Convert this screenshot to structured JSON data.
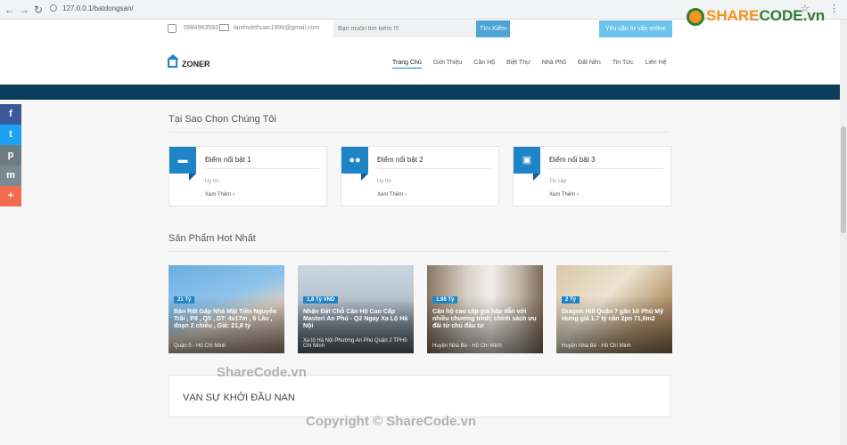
{
  "browser": {
    "url": "127.0.0.1/batdongsan/"
  },
  "topbar": {
    "phone": "0984963593",
    "email": "lamhviethuan1996@gmail.com",
    "search_placeholder": "Bạn muốn tìm kiếm !!!",
    "search_button": "Tìm Kiếm",
    "consult_button": "Yêu cầu tư vấn online"
  },
  "header": {
    "logo": "ZONER",
    "menu": [
      "Trang Chủ",
      "Giới Thiệu",
      "Căn Hộ",
      "Biệt Thự",
      "Nhà Phố",
      "Đất Nền",
      "Tin Tức",
      "Liên Hệ"
    ]
  },
  "social": [
    "f",
    "t",
    "p",
    "m",
    "+"
  ],
  "why": {
    "title": "Tại Sao Chọn Chúng Tôi",
    "features": [
      {
        "title": "Điểm nổi bật 1",
        "desc": "Uy tín",
        "more": "Xem Thêm"
      },
      {
        "title": "Điểm nổi bật 2",
        "desc": "Uy tín",
        "more": "Xem Thêm"
      },
      {
        "title": "Điểm nổi bật 3",
        "desc": "Tin cậy",
        "more": "Xem Thêm"
      }
    ]
  },
  "products": {
    "title": "Sản Phẩm Hot Nhất",
    "items": [
      {
        "price": "21 Tỷ",
        "title": "Bán Rất Gấp Nhà Mặt Tiền Nguyễn Trãi , P8 , Q5 , DT: 4x17m , 6 Lầu , đoạn 2 chiều , Giá: 21,8 tỷ",
        "location": "Quận 5 - Hồ Chí Minh"
      },
      {
        "price": "1,8 Tỷ VND",
        "title": "Nhận Đặt Chỗ Căn Hộ Cao Cấp Masteri An Phú - Q2 Ngay Xa Lộ Hà Nội",
        "location": "Xa lộ Hà Nội Phường An Phú Quận 2 TPHồ Chí Minh"
      },
      {
        "price": "1.98 Tỷ",
        "title": "Căn hộ cao cấp giá hấp dẫn với nhiều chương trình, chính sách ưu đãi từ chủ đầu tư",
        "location": "Huyện Nhà Bè - Hồ Chí Minh"
      },
      {
        "price": "2 Tỷ",
        "title": "Dragon Hill Quận 7 gần kề Phú Mỹ Hưng giá 1.7 tỷ căn 2pn 71,6m2",
        "location": "Huyện Nhà Bè - Hồ Chí Minh"
      }
    ]
  },
  "start": {
    "title": "VẠN SỰ KHỞI ĐẦU NAN"
  },
  "watermarks": {
    "logo_a": "SHARE",
    "logo_b": "CODE.vn",
    "mid": "ShareCode.vn",
    "bottom": "Copyright © ShareCode.vn"
  },
  "colors": {
    "accent": "#1d84c6",
    "band": "#0b3d5c",
    "facebook": "#3b5998",
    "twitter": "#1da1f2",
    "print": "#6d7b82",
    "mail": "#7b8a91",
    "plus": "#f26c4f"
  }
}
